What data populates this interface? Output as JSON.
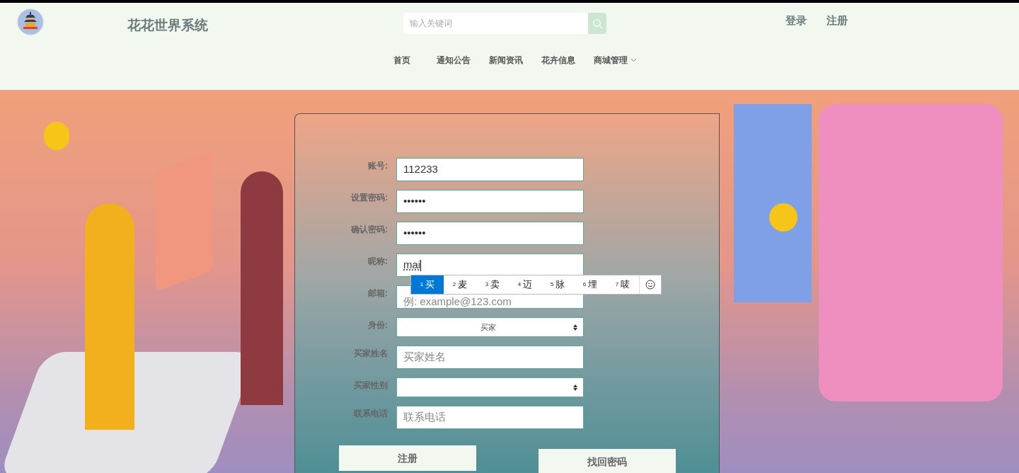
{
  "header": {
    "title": "花花世界系统",
    "search": {
      "placeholder": "输入关键词"
    },
    "auth_links": [
      "登录",
      "注册"
    ]
  },
  "nav": [
    {
      "label": "首页",
      "dropdown": false
    },
    {
      "label": "通知公告",
      "dropdown": false
    },
    {
      "label": "新闻资讯",
      "dropdown": false
    },
    {
      "label": "花卉信息",
      "dropdown": false
    },
    {
      "label": "商城管理",
      "dropdown": true
    }
  ],
  "form": {
    "fields": [
      {
        "kind": "text",
        "label": "账号:",
        "value": "112233"
      },
      {
        "kind": "text",
        "label": "设置密码:",
        "value": "••••••"
      },
      {
        "kind": "text",
        "label": "确认密码:",
        "value": "••••••"
      },
      {
        "kind": "text",
        "label": "昵称:",
        "value": "mai",
        "composing": true
      },
      {
        "kind": "text",
        "label": "邮箱:",
        "placeholder": "例: example@123.com"
      },
      {
        "kind": "select",
        "label": "身份:",
        "value": "买家"
      },
      {
        "kind": "text",
        "label": "买家姓名",
        "placeholder": "买家姓名"
      },
      {
        "kind": "select",
        "label": "买家性别"
      },
      {
        "kind": "text",
        "label": "联系电话",
        "placeholder": "联系电话"
      }
    ],
    "buttons": [
      "注册",
      "找回密码"
    ]
  },
  "ime": {
    "candidates": [
      {
        "index": "1",
        "text": "买",
        "selected": true
      },
      {
        "index": "2",
        "text": "麦",
        "selected": false
      },
      {
        "index": "3",
        "text": "卖",
        "selected": false
      },
      {
        "index": "4",
        "text": "迈",
        "selected": false
      },
      {
        "index": "5",
        "text": "脉",
        "selected": false
      },
      {
        "index": "6",
        "text": "埋",
        "selected": false
      },
      {
        "index": "7",
        "text": "唛",
        "selected": false
      }
    ]
  }
}
